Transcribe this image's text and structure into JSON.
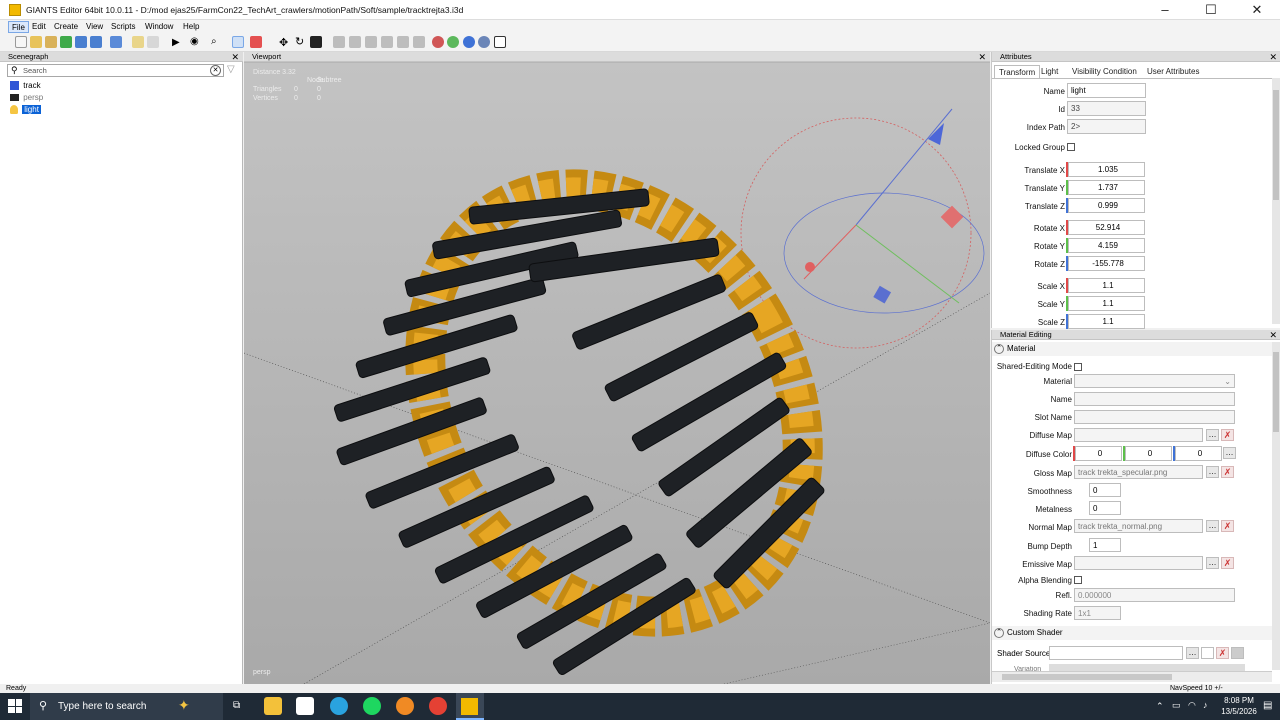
{
  "window": {
    "title": "GIANTS Editor 64bit 10.0.11 - D:/mod ejas25/FarmCon22_TechArt_crawlers/motionPath/Soft/sample/tracktrejta3.i3d"
  },
  "menu": [
    "File",
    "Edit",
    "Create",
    "View",
    "Scripts",
    "Window",
    "Help"
  ],
  "scenegraph": {
    "title": "Scenegraph",
    "search_placeholder": "Search",
    "items": [
      {
        "label": "track",
        "icon": "cube-icon"
      },
      {
        "label": "persp",
        "icon": "camera-icon"
      },
      {
        "label": "light",
        "icon": "lightbulb-icon",
        "selected": true
      }
    ]
  },
  "viewport": {
    "title": "Viewport",
    "distance": "Distance 3.32",
    "stats_header": [
      "Node",
      "Subtree"
    ],
    "stats": [
      {
        "label": "Triangles",
        "node": "0",
        "subtree": "0"
      },
      {
        "label": "Vertices",
        "node": "0",
        "subtree": "0"
      }
    ],
    "camera": "persp"
  },
  "attributes": {
    "title": "Attributes",
    "tabs": [
      "Transform",
      "Light",
      "Visibility Condition",
      "User Attributes"
    ],
    "name_label": "Name",
    "name": "light",
    "id_label": "Id",
    "id": "33",
    "index_label": "Index Path",
    "index_path": "2>",
    "locked_label": "Locked Group",
    "transform": [
      {
        "label": "Translate X",
        "value": "1.035",
        "axis": "#e04848"
      },
      {
        "label": "Translate Y",
        "value": "1.737",
        "axis": "#5cbf4a"
      },
      {
        "label": "Translate Z",
        "value": "0.999",
        "axis": "#3f72d6"
      },
      {
        "label": "Rotate X",
        "value": "52.914",
        "axis": "#e04848"
      },
      {
        "label": "Rotate Y",
        "value": "4.159",
        "axis": "#5cbf4a"
      },
      {
        "label": "Rotate Z",
        "value": "-155.778",
        "axis": "#3f72d6"
      },
      {
        "label": "Scale X",
        "value": "1.1",
        "axis": "#e04848"
      },
      {
        "label": "Scale Y",
        "value": "1.1",
        "axis": "#5cbf4a"
      },
      {
        "label": "Scale Z",
        "value": "1.1",
        "axis": "#3f72d6"
      }
    ]
  },
  "material": {
    "title": "Material Editing",
    "section": "Material",
    "shared_label": "Shared-Editing Mode",
    "material_label": "Material",
    "name_label": "Name",
    "slot_label": "Slot Name",
    "diffuse_map_label": "Diffuse Map",
    "diffuse_color_label": "Diffuse Color",
    "diffuse_color": [
      "0",
      "0",
      "0"
    ],
    "gloss_label": "Gloss Map",
    "gloss_map": "track trekta_specular.png",
    "smooth_label": "Smoothness",
    "smoothness": "0",
    "metal_label": "Metalness",
    "metalness": "0",
    "normal_label": "Normal Map",
    "normal_map": "track trekta_normal.png",
    "bump_label": "Bump Depth",
    "bump_depth": "1",
    "emissive_label": "Emissive Map",
    "alpha_label": "Alpha Blending",
    "refl_label": "Refl.",
    "refl": "0.000000",
    "shading_label": "Shading Rate",
    "shading_rate": "1x1",
    "custom_shader": "Custom Shader",
    "shader_source_label": "Shader Source",
    "variation_label": "Variation"
  },
  "status": {
    "left": "Ready",
    "right": "NavSpeed 10 +/-"
  },
  "taskbar": {
    "search_placeholder": "Type here to search",
    "time": "8:08 PM",
    "date": "13/5/2026"
  }
}
